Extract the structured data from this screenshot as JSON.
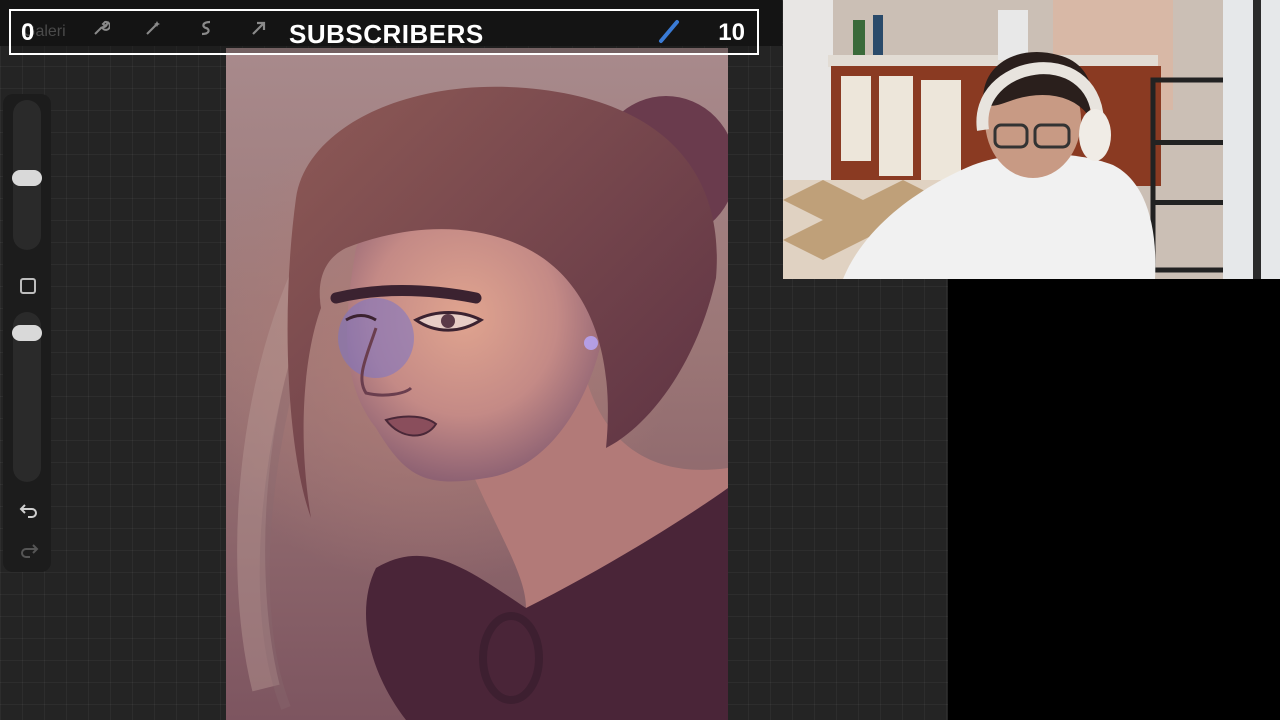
{
  "overlay": {
    "subscriber_count_left": "0",
    "title": "SUBSCRIBERS",
    "subscriber_count_right": "10"
  },
  "toolbar": {
    "gallery_label": "Galeri",
    "icons": [
      "wrench-icon",
      "magic-wand-icon",
      "selection-icon",
      "transform-arrow-icon",
      "brush-icon"
    ]
  },
  "sidebar": {
    "icons": [
      "undo-icon",
      "redo-icon"
    ]
  },
  "colors": {
    "app_background": "#242424",
    "topbar": "#141414",
    "brush_blue": "#3a7bd5",
    "overlay_border": "#ffffff"
  }
}
